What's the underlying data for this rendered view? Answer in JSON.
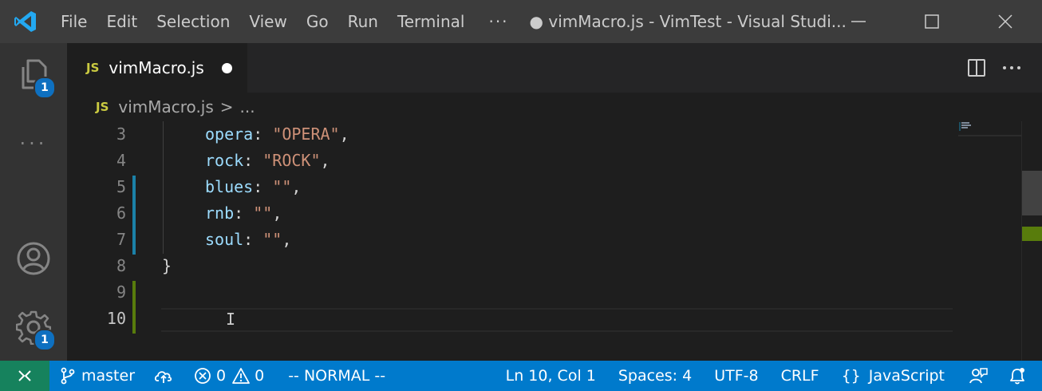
{
  "titlebar": {
    "logo_icon": "vscode-logo",
    "menu": [
      "File",
      "Edit",
      "Selection",
      "View",
      "Go",
      "Run",
      "Terminal"
    ],
    "menu_more": "···",
    "window_title": "● vimMacro.js - VimTest - Visual Studi...",
    "controls": [
      "minimize-icon",
      "maximize-icon",
      "close-icon"
    ]
  },
  "activity_bar": {
    "explorer_badge": "1",
    "more": "···",
    "settings_badge": "1"
  },
  "tab": {
    "icon_text": "JS",
    "label": "vimMacro.js",
    "dirty": true
  },
  "breadcrumb": {
    "icon_text": "JS",
    "file": "vimMacro.js",
    "separator": ">",
    "ellipsis": "..."
  },
  "editor": {
    "lines": [
      {
        "no": "3",
        "key": "opera",
        "colon": ": ",
        "str": "\"OPERA\"",
        "tail": ","
      },
      {
        "no": "4",
        "key": "rock",
        "colon": ": ",
        "str": "\"ROCK\"",
        "tail": ","
      },
      {
        "no": "5",
        "key": "blues",
        "colon": ": ",
        "str": "\"\"",
        "tail": ","
      },
      {
        "no": "6",
        "key": "rnb",
        "colon": ": ",
        "str": "\"\"",
        "tail": ","
      },
      {
        "no": "7",
        "key": "soul",
        "colon": ": ",
        "str": "\"\"",
        "tail": ","
      },
      {
        "no": "8",
        "brace": "}"
      },
      {
        "no": "9"
      },
      {
        "no": "10"
      }
    ],
    "ibeam": "I",
    "colors": {
      "modified": "#1b81a8",
      "added": "#587c0c"
    }
  },
  "statusbar": {
    "branch": "master",
    "errors": "0",
    "warnings": "0",
    "mode": "-- NORMAL --",
    "position": "Ln 10, Col 1",
    "spaces": "Spaces: 4",
    "encoding": "UTF-8",
    "eol": "CRLF",
    "language_braces": "{}",
    "language": "JavaScript"
  }
}
